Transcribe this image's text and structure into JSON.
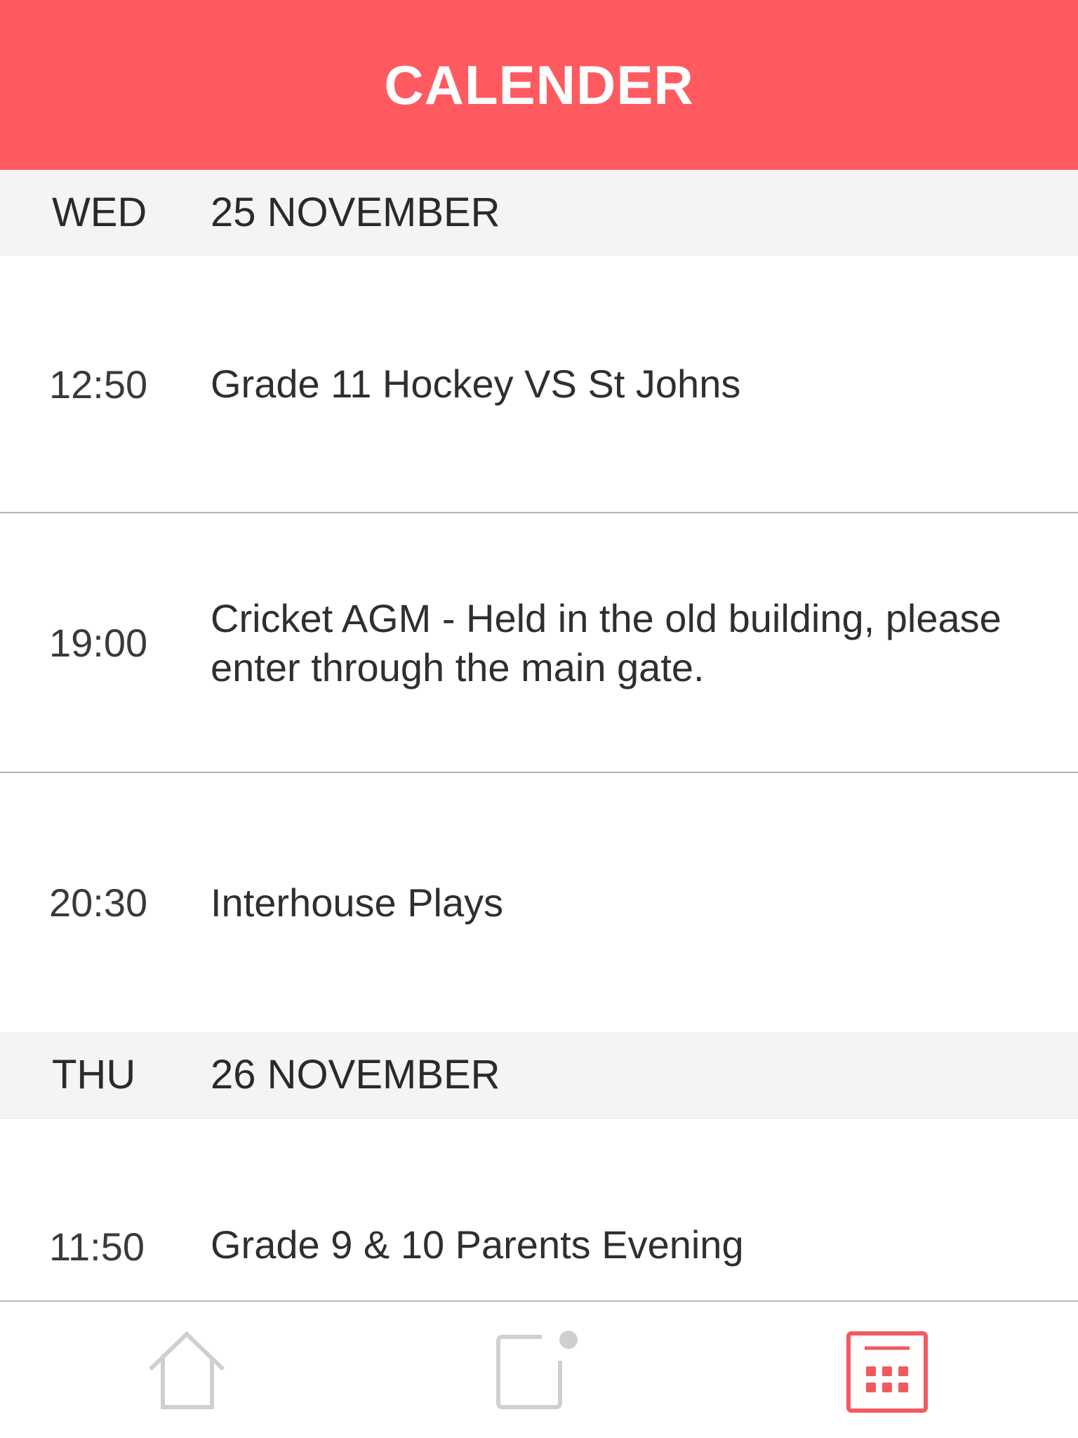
{
  "header": {
    "title": "CALENDER"
  },
  "days": [
    {
      "dow": "WED",
      "date": "25 NOVEMBER",
      "events": [
        {
          "time": "12:50",
          "title": "Grade 11 Hockey VS St Johns"
        },
        {
          "time": "19:00",
          "title": "Cricket AGM - Held in the old building, please enter through the main gate."
        },
        {
          "time": "20:30",
          "title": "Interhouse Plays"
        }
      ]
    },
    {
      "dow": "THU",
      "date": "26 NOVEMBER",
      "events": [
        {
          "time": "11:50",
          "title": "Grade 9 & 10 Parents Evening"
        }
      ]
    }
  ],
  "tabbar": {
    "items": [
      {
        "icon": "home-icon",
        "active": false
      },
      {
        "icon": "notifications-icon",
        "active": false,
        "has_badge": true
      },
      {
        "icon": "calendar-icon",
        "active": true
      }
    ],
    "active_color": "#f25a5f",
    "inactive_color": "#cfcfcf"
  },
  "colors": {
    "accent": "#ff5a5f",
    "day_header_bg": "#f4f4f4"
  }
}
